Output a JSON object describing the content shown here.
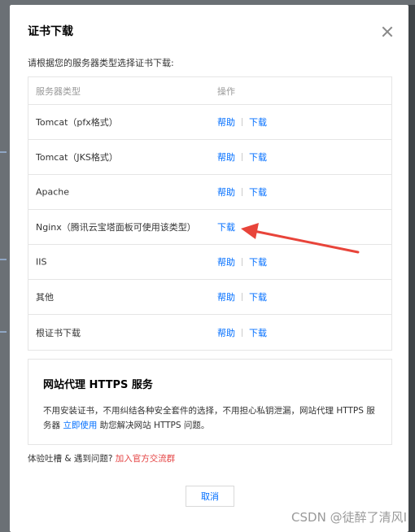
{
  "dialog": {
    "title": "证书下载",
    "instruction": "请根据您的服务器类型选择证书下载:",
    "table": {
      "col_server_type": "服务器类型",
      "col_operation": "操作",
      "rows": [
        {
          "name": "Tomcat（pfx格式）",
          "help": "帮助",
          "download": "下载"
        },
        {
          "name": "Tomcat（JKS格式）",
          "help": "帮助",
          "download": "下载"
        },
        {
          "name": "Apache",
          "help": "帮助",
          "download": "下载"
        },
        {
          "name": "Nginx（腾讯云宝塔面板可使用该类型）",
          "help": "",
          "download": "下载"
        },
        {
          "name": "IIS",
          "help": "帮助",
          "download": "下载"
        },
        {
          "name": "其他",
          "help": "帮助",
          "download": "下载"
        },
        {
          "name": "根证书下载",
          "help": "帮助",
          "download": "下载"
        }
      ]
    },
    "promo": {
      "title": "网站代理 HTTPS 服务",
      "desc_before": "不用安装证书，不用纠结各种安全套件的选择，不用担心私钥泄漏，网站代理 HTTPS 服务器 ",
      "desc_link": "立即使用",
      "desc_after": " 助您解决网站 HTTPS 问题。"
    },
    "feedback": {
      "text": "体验吐槽 & 遇到问题? ",
      "link": "加入官方交流群"
    },
    "cancel_label": "取消"
  },
  "annotation": {
    "arrow_color": "#e8443a"
  },
  "watermark": "CSDN @徒醉了清风I",
  "colors": {
    "link": "#006eff",
    "accent_red": "#e54545",
    "overlay": "#3f4448"
  }
}
